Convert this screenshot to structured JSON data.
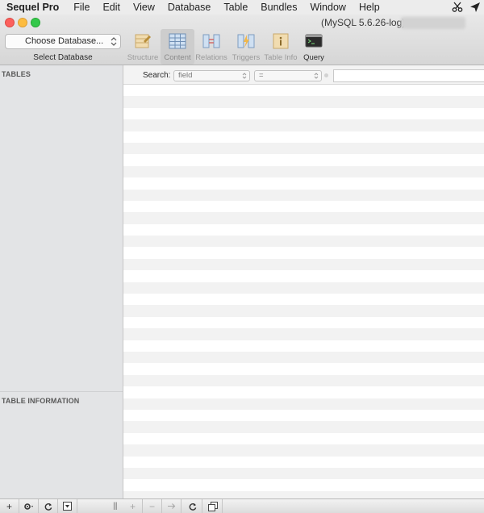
{
  "menubar": {
    "app_name": "Sequel Pro",
    "items": [
      "File",
      "Edit",
      "View",
      "Database",
      "Table",
      "Bundles",
      "Window",
      "Help"
    ]
  },
  "window": {
    "title": "(MySQL 5.6.26-log)"
  },
  "database_selector": {
    "value": "Choose Database...",
    "caption": "Select Database"
  },
  "toolbar": {
    "buttons": [
      {
        "label": "Structure",
        "state": "disabled"
      },
      {
        "label": "Content",
        "state": "selected"
      },
      {
        "label": "Relations",
        "state": "disabled"
      },
      {
        "label": "Triggers",
        "state": "disabled"
      },
      {
        "label": "Table Info",
        "state": "disabled"
      },
      {
        "label": "Query",
        "state": "enabled"
      }
    ]
  },
  "sidebar": {
    "tables_header": "TABLES",
    "table_info_header": "TABLE INFORMATION"
  },
  "search": {
    "label": "Search:",
    "field_value": "field",
    "operator_value": "=",
    "value": ""
  },
  "colors": {
    "close": "#fc605c",
    "minimize": "#fdbc40",
    "maximize": "#34c84a",
    "sidebar_bg": "#e3e4e6",
    "row_alt": "#f2f2f2"
  }
}
